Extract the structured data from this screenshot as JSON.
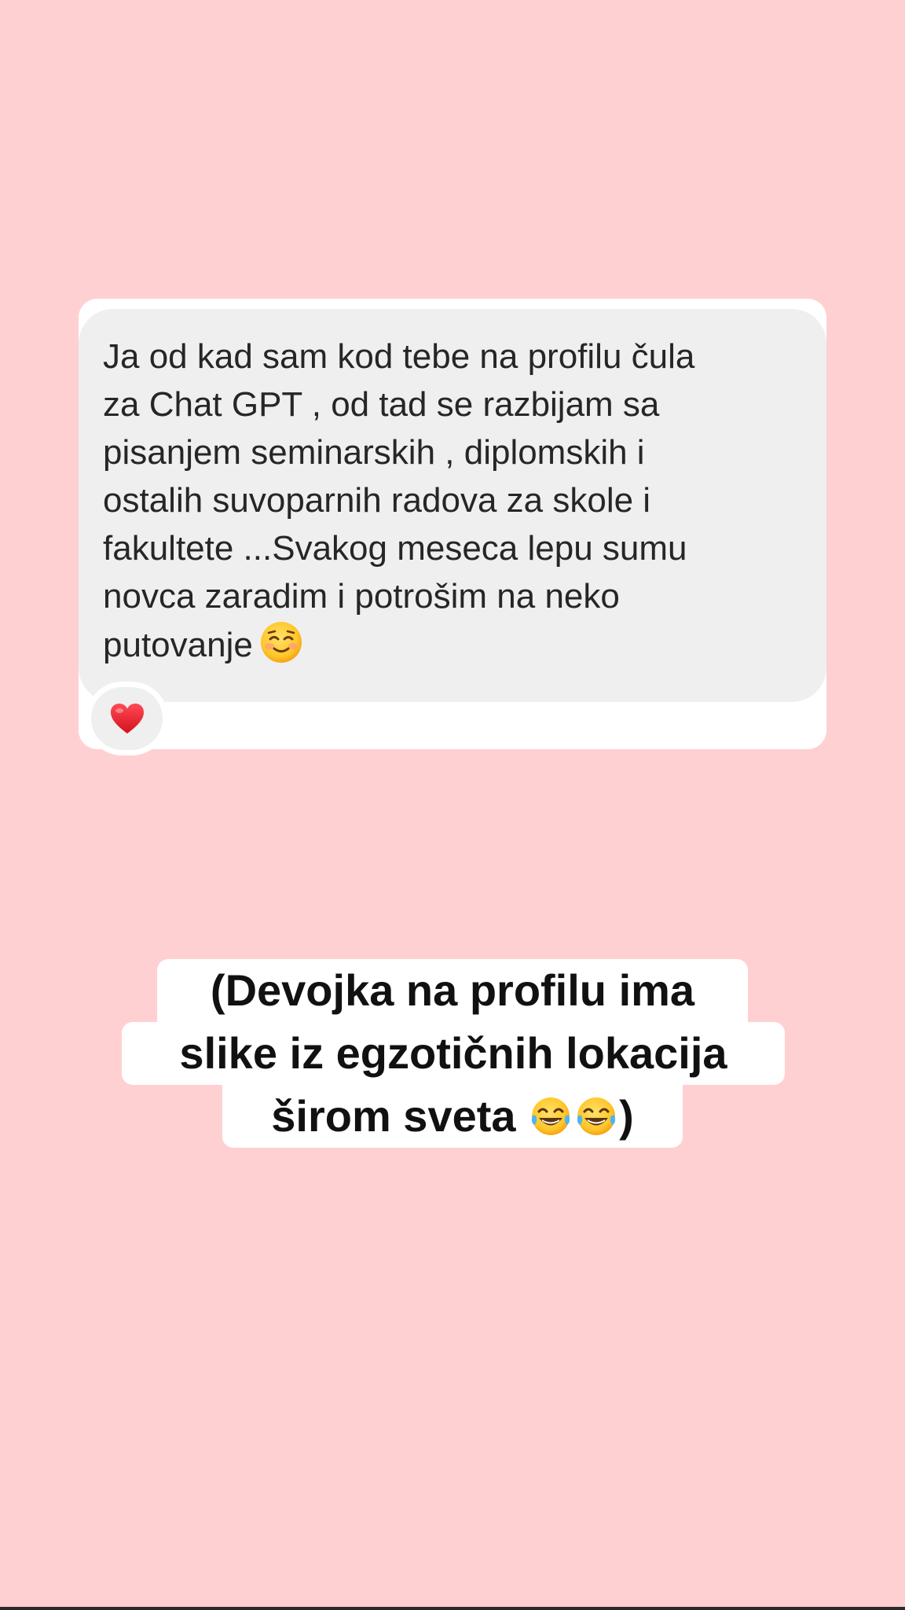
{
  "message": {
    "lines": [
      "Ja od kad sam kod tebe na profilu čula",
      "za Chat GPT , od tad se razbijam sa",
      "pisanjem seminarskih , diplomskih i",
      "ostalih suvoparnih radova za skole i",
      "fakultete ...Svakog meseca lepu sumu",
      "novca zaradim i potrošim na neko",
      "putovanje"
    ],
    "emoji": "smiling-face-with-blush-icon",
    "reaction": "red-heart-icon"
  },
  "caption": {
    "line1": "(Devojka na profilu ima",
    "line2": "slike iz egzotičnih lokacija",
    "line3_text": "širom sveta",
    "line3_emoji": "face-with-tears-of-joy-icon",
    "line3_close": ")"
  },
  "colors": {
    "background": "#ffd0d2",
    "bubble": "#efefef",
    "card": "#ffffff",
    "message_text": "#262626",
    "caption_text": "#111111",
    "heart": "#e8202c"
  }
}
